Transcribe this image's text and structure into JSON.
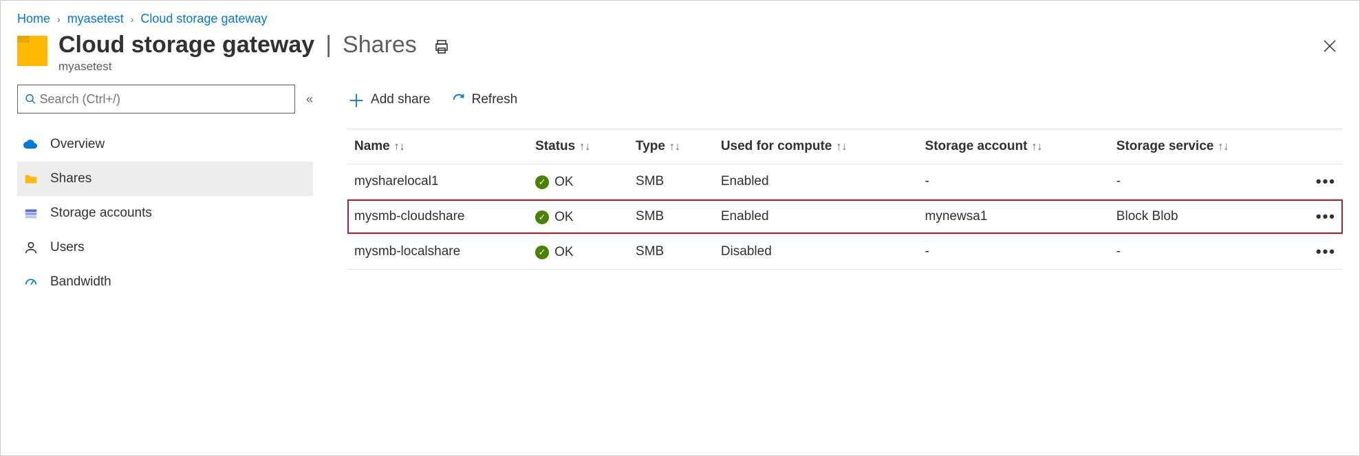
{
  "breadcrumb": [
    {
      "label": "Home"
    },
    {
      "label": "myasetest"
    },
    {
      "label": "Cloud storage gateway"
    }
  ],
  "header": {
    "title": "Cloud storage gateway",
    "section": "Shares",
    "subtitle": "myasetest"
  },
  "search": {
    "placeholder": "Search (Ctrl+/)"
  },
  "sidebar": {
    "items": [
      {
        "icon": "cloud-icon",
        "label": "Overview",
        "active": false
      },
      {
        "icon": "folder-icon",
        "label": "Shares",
        "active": true
      },
      {
        "icon": "storage-icon",
        "label": "Storage accounts",
        "active": false
      },
      {
        "icon": "user-icon",
        "label": "Users",
        "active": false
      },
      {
        "icon": "gauge-icon",
        "label": "Bandwidth",
        "active": false
      }
    ]
  },
  "toolbar": {
    "add_label": "Add share",
    "refresh_label": "Refresh"
  },
  "table": {
    "columns": [
      "Name",
      "Status",
      "Type",
      "Used for compute",
      "Storage account",
      "Storage service"
    ],
    "rows": [
      {
        "name": "mysharelocal1",
        "status": "OK",
        "type": "SMB",
        "compute": "Enabled",
        "account": "-",
        "service": "-",
        "highlight": false
      },
      {
        "name": "mysmb-cloudshare",
        "status": "OK",
        "type": "SMB",
        "compute": "Enabled",
        "account": "mynewsa1",
        "service": "Block Blob",
        "highlight": true
      },
      {
        "name": "mysmb-localshare",
        "status": "OK",
        "type": "SMB",
        "compute": "Disabled",
        "account": "-",
        "service": "-",
        "highlight": false
      }
    ]
  }
}
